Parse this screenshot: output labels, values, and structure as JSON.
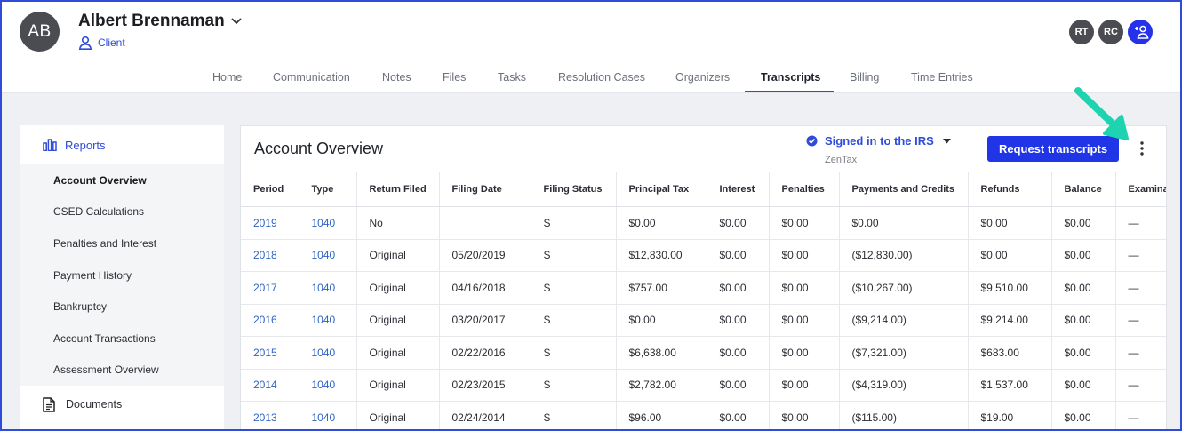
{
  "header": {
    "avatar_initials": "AB",
    "client_name": "Albert Brennaman",
    "client_role": "Client",
    "team": [
      "RT",
      "RC"
    ],
    "nav": [
      "Home",
      "Communication",
      "Notes",
      "Files",
      "Tasks",
      "Resolution Cases",
      "Organizers",
      "Transcripts",
      "Billing",
      "Time Entries"
    ],
    "active_tab": "Transcripts"
  },
  "sidebar": {
    "reports_label": "Reports",
    "items": [
      "Account Overview",
      "CSED Calculations",
      "Penalties and Interest",
      "Payment History",
      "Bankruptcy",
      "Account Transactions",
      "Assessment Overview"
    ],
    "active_item": "Account Overview",
    "documents_label": "Documents"
  },
  "panel": {
    "title": "Account Overview",
    "irs_status": "Signed in to the IRS",
    "irs_account": "ZenTax",
    "request_button": "Request transcripts"
  },
  "table": {
    "headers": [
      "Period",
      "Type",
      "Return Filed",
      "Filing Date",
      "Filing Status",
      "Principal Tax",
      "Interest",
      "Penalties",
      "Payments and Credits",
      "Refunds",
      "Balance",
      "Examina"
    ],
    "rows": [
      [
        "2019",
        "1040",
        "No",
        "",
        "S",
        "$0.00",
        "$0.00",
        "$0.00",
        "$0.00",
        "$0.00",
        "$0.00",
        "—"
      ],
      [
        "2018",
        "1040",
        "Original",
        "05/20/2019",
        "S",
        "$12,830.00",
        "$0.00",
        "$0.00",
        "($12,830.00)",
        "$0.00",
        "$0.00",
        "—"
      ],
      [
        "2017",
        "1040",
        "Original",
        "04/16/2018",
        "S",
        "$757.00",
        "$0.00",
        "$0.00",
        "($10,267.00)",
        "$9,510.00",
        "$0.00",
        "—"
      ],
      [
        "2016",
        "1040",
        "Original",
        "03/20/2017",
        "S",
        "$0.00",
        "$0.00",
        "$0.00",
        "($9,214.00)",
        "$9,214.00",
        "$0.00",
        "—"
      ],
      [
        "2015",
        "1040",
        "Original",
        "02/22/2016",
        "S",
        "$6,638.00",
        "$0.00",
        "$0.00",
        "($7,321.00)",
        "$683.00",
        "$0.00",
        "—"
      ],
      [
        "2014",
        "1040",
        "Original",
        "02/23/2015",
        "S",
        "$2,782.00",
        "$0.00",
        "$0.00",
        "($4,319.00)",
        "$1,537.00",
        "$0.00",
        "—"
      ],
      [
        "2013",
        "1040",
        "Original",
        "02/24/2014",
        "S",
        "$96.00",
        "$0.00",
        "$0.00",
        "($115.00)",
        "$19.00",
        "$0.00",
        "—"
      ]
    ]
  },
  "colors": {
    "accent": "#2f4bd8",
    "button": "#1f35e6",
    "link": "#2f63c2",
    "annotation_arrow": "#1ed3b0"
  }
}
